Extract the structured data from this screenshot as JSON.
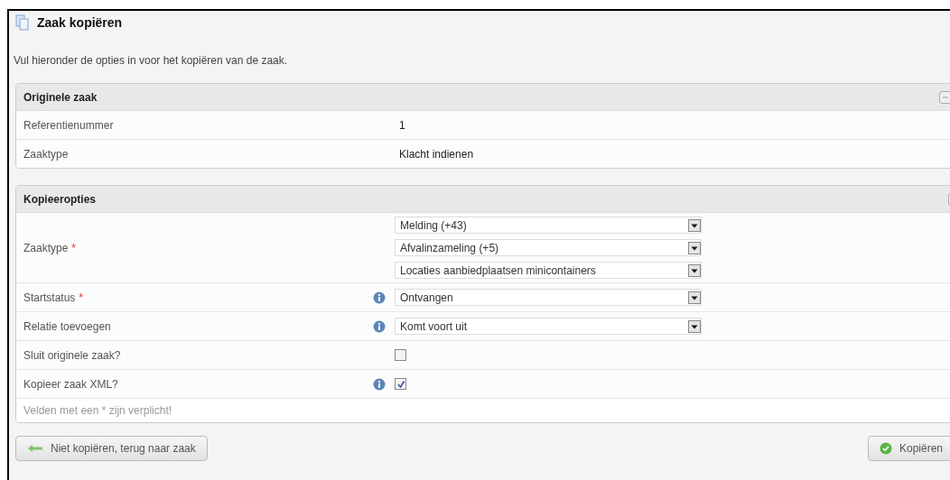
{
  "window": {
    "title": "Zaak kopiëren"
  },
  "intro": "Vul hieronder de opties in voor het kopiëren van de zaak.",
  "original": {
    "title": "Originele zaak",
    "collapsed": false,
    "rows": [
      {
        "label": "Referentienummer",
        "value": "1"
      },
      {
        "label": "Zaaktype",
        "value": "Klacht indienen"
      }
    ]
  },
  "options": {
    "title": "Kopieeropties",
    "fields": [
      {
        "kind": "selects",
        "label": "Zaaktype",
        "required_mark": "*",
        "info": false,
        "selects": [
          "Melding (+43)",
          "Afvalinzameling (+5)",
          "Locaties aanbiedplaatsen minicontainers"
        ]
      },
      {
        "kind": "selects",
        "label": "Startstatus",
        "required_mark": "*",
        "info": true,
        "selects": [
          "Ontvangen"
        ]
      },
      {
        "kind": "selects",
        "label": "Relatie toevoegen",
        "info": true,
        "selects": [
          "Komt voort uit"
        ]
      },
      {
        "kind": "checkbox",
        "label": "Sluit originele zaak?",
        "info": false,
        "checked": false
      },
      {
        "kind": "checkbox",
        "label": "Kopieer zaak XML?",
        "info": true,
        "checked": true
      }
    ],
    "footnote": "Velden met een * zijn verplicht!"
  },
  "buttons": {
    "cancel": "Niet kopiëren, terug naar zaak",
    "submit": "Kopiëren"
  }
}
